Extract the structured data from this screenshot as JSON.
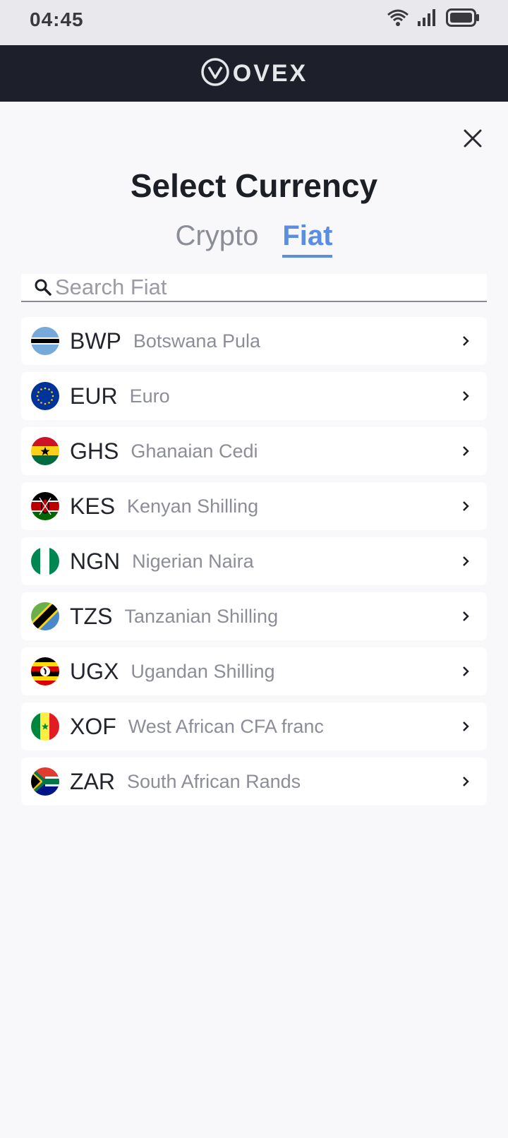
{
  "status_bar": {
    "time": "04:45",
    "icons": [
      "wifi-icon",
      "signal-icon",
      "battery-icon"
    ]
  },
  "header": {
    "logo_text": "OVEX",
    "logo_icon": "ovex-v-logo"
  },
  "modal": {
    "close_icon": "close-icon",
    "title": "Select Currency",
    "tabs": [
      {
        "label": "Crypto",
        "active": false
      },
      {
        "label": "Fiat",
        "active": true
      }
    ],
    "search": {
      "placeholder": "Search Fiat",
      "value": "",
      "icon": "search-icon"
    }
  },
  "currencies": [
    {
      "code": "BWP",
      "name": "Botswana Pula",
      "flag": "botswana-flag-icon"
    },
    {
      "code": "EUR",
      "name": "Euro",
      "flag": "eu-flag-icon"
    },
    {
      "code": "GHS",
      "name": "Ghanaian Cedi",
      "flag": "ghana-flag-icon"
    },
    {
      "code": "KES",
      "name": "Kenyan Shilling",
      "flag": "kenya-flag-icon"
    },
    {
      "code": "NGN",
      "name": "Nigerian Naira",
      "flag": "nigeria-flag-icon"
    },
    {
      "code": "TZS",
      "name": "Tanzanian Shilling",
      "flag": "tanzania-flag-icon"
    },
    {
      "code": "UGX",
      "name": "Ugandan Shilling",
      "flag": "uganda-flag-icon"
    },
    {
      "code": "XOF",
      "name": "West African CFA franc",
      "flag": "senegal-flag-icon"
    },
    {
      "code": "ZAR",
      "name": "South African Rands",
      "flag": "south-africa-flag-icon"
    }
  ],
  "colors": {
    "accent": "#5b8de3",
    "header_bg": "#1d202b",
    "page_bg": "#f8f8fa"
  }
}
